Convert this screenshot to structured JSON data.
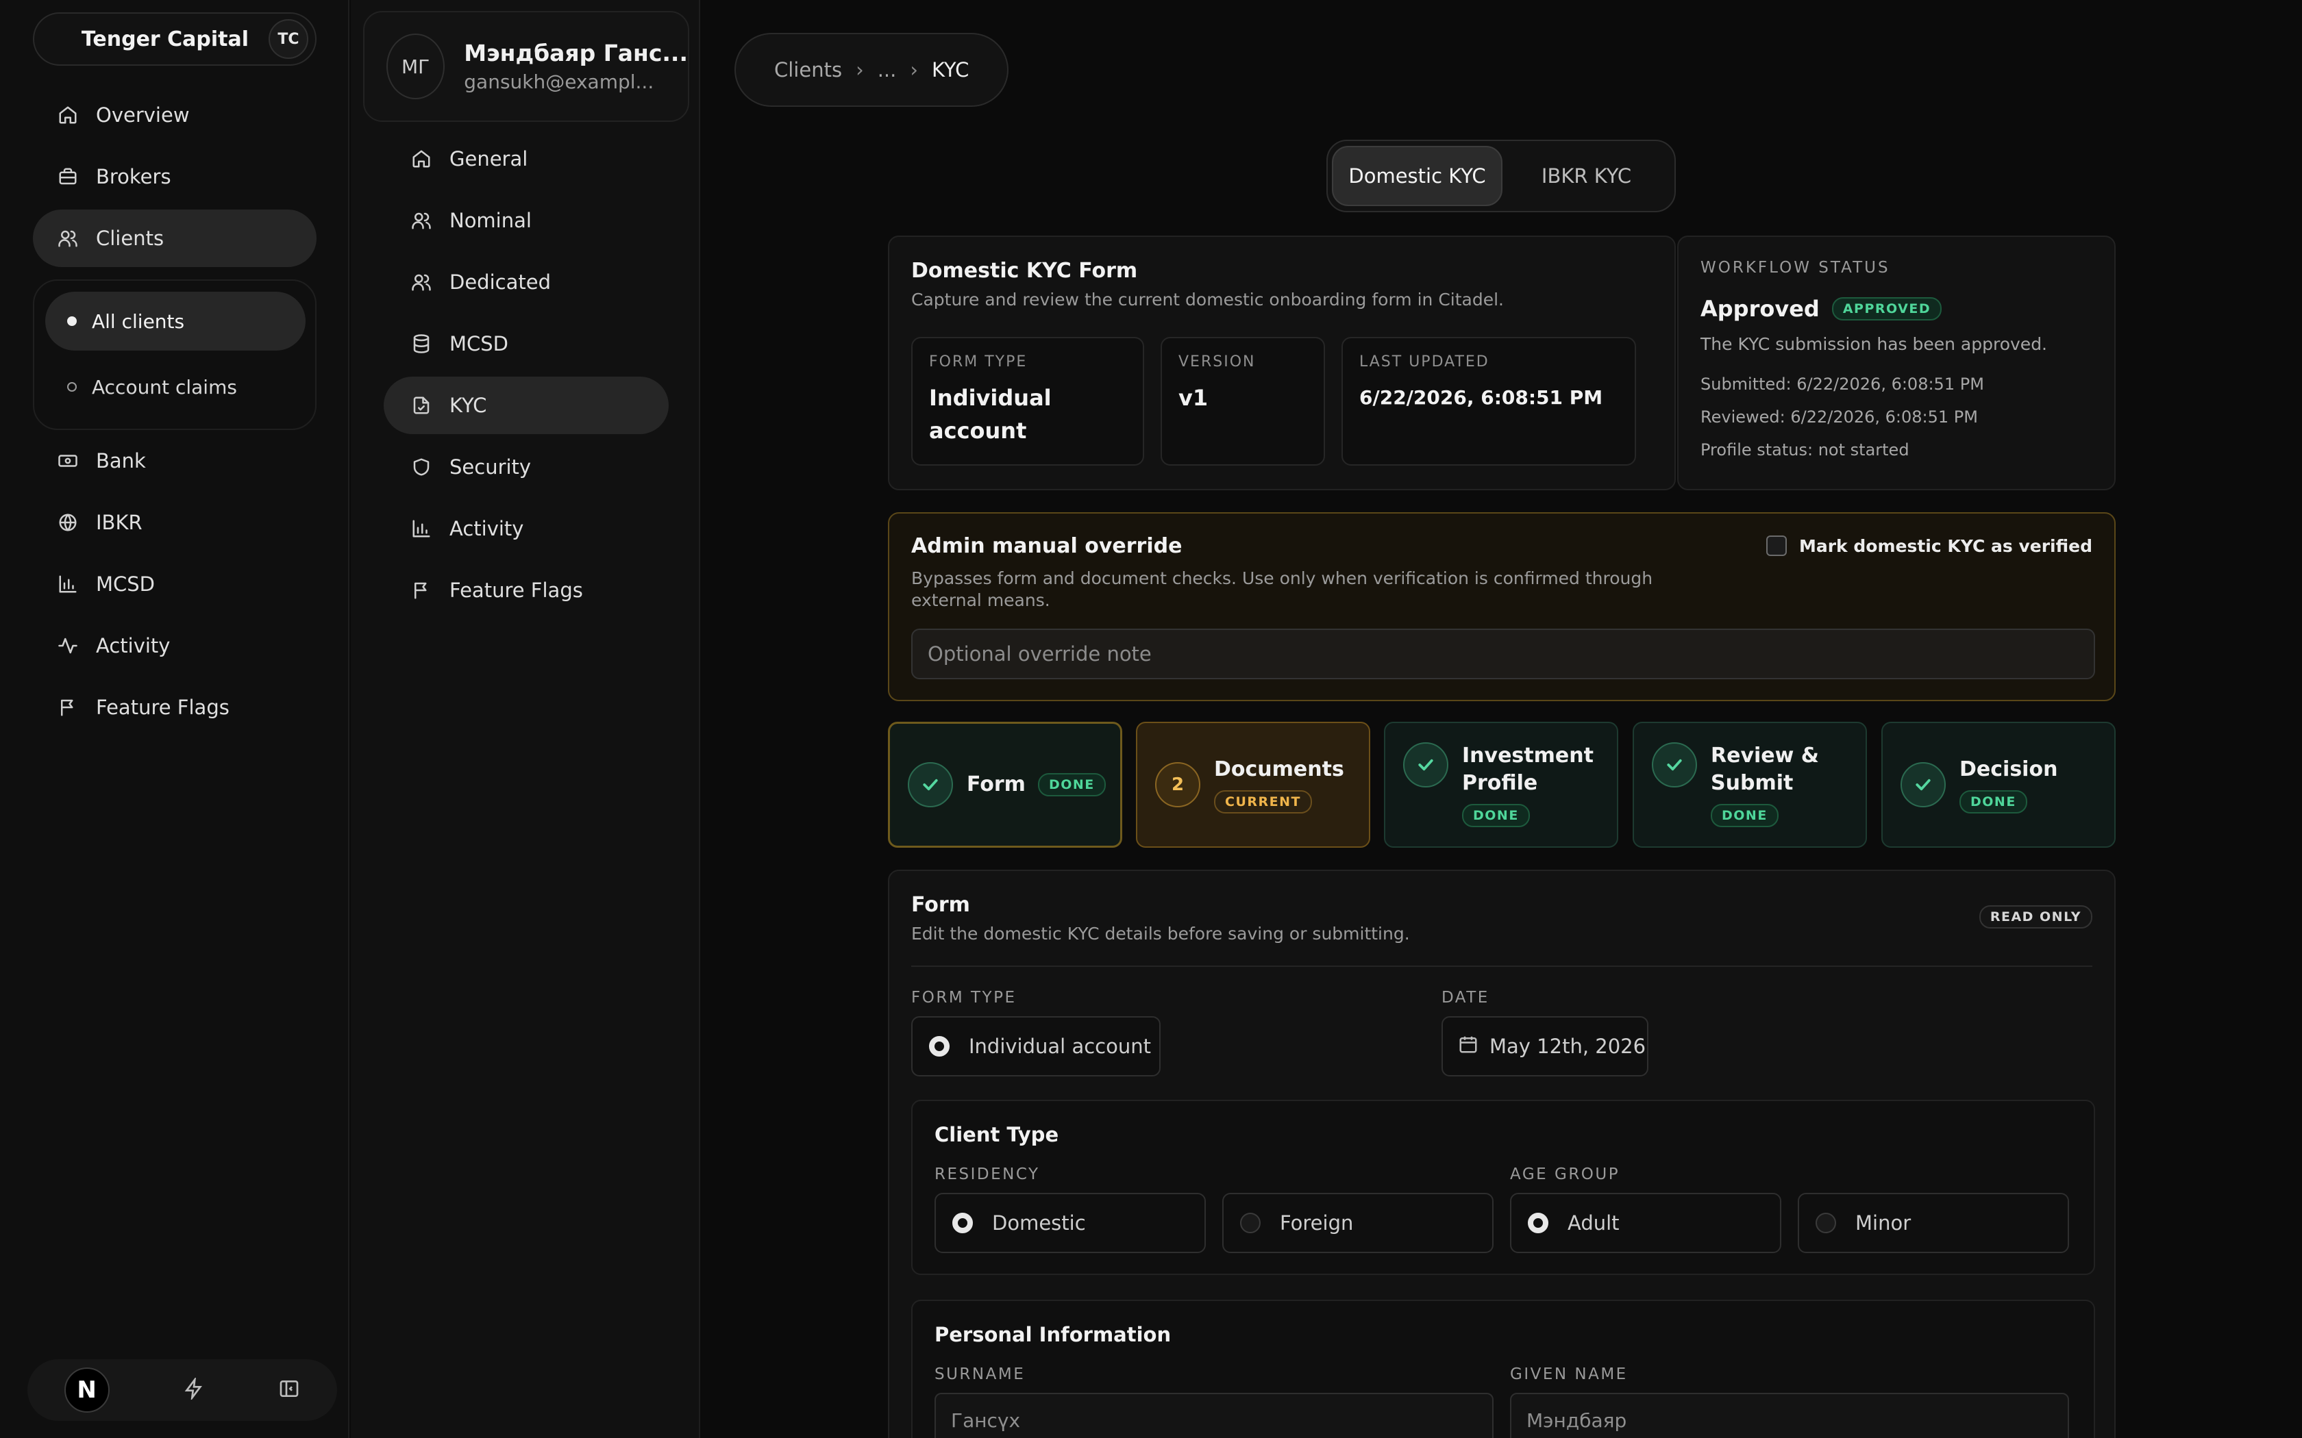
{
  "org": {
    "name": "Tenger Capital",
    "badge": "TC"
  },
  "sidebar": {
    "items": [
      {
        "label": "Overview",
        "icon": "home-icon"
      },
      {
        "label": "Brokers",
        "icon": "briefcase-icon"
      },
      {
        "label": "Clients",
        "icon": "users-icon"
      }
    ],
    "sub_items": [
      {
        "label": "All clients"
      },
      {
        "label": "Account claims"
      }
    ],
    "items_after": [
      {
        "label": "Bank",
        "icon": "banknote-icon"
      },
      {
        "label": "IBKR",
        "icon": "globe-icon"
      },
      {
        "label": "MCSD",
        "icon": "bar-chart-icon"
      },
      {
        "label": "Activity",
        "icon": "activity-icon"
      },
      {
        "label": "Feature Flags",
        "icon": "flag-icon"
      }
    ],
    "footer_logo": "N"
  },
  "client": {
    "initials": "МГ",
    "name": "Мэндбаяр Ганс...",
    "email": "gansukh@exampl...",
    "nav": [
      {
        "label": "General",
        "icon": "home-icon"
      },
      {
        "label": "Nominal",
        "icon": "users-icon"
      },
      {
        "label": "Dedicated",
        "icon": "users-icon"
      },
      {
        "label": "MCSD",
        "icon": "database-icon"
      },
      {
        "label": "KYC",
        "icon": "file-check-icon"
      },
      {
        "label": "Security",
        "icon": "shield-icon"
      },
      {
        "label": "Activity",
        "icon": "bar-chart-icon"
      },
      {
        "label": "Feature Flags",
        "icon": "flag-icon"
      }
    ]
  },
  "breadcrumb": {
    "root": "Clients",
    "ellipsis": "...",
    "current": "KYC"
  },
  "tabs": [
    "Domestic KYC",
    "IBKR KYC"
  ],
  "kyc_form": {
    "title": "Domestic KYC Form",
    "subtitle": "Capture and review the current domestic onboarding form in Citadel.",
    "form_type_label": "FORM TYPE",
    "form_type_value": "Individual account",
    "version_label": "VERSION",
    "version_value": "v1",
    "updated_label": "LAST UPDATED",
    "updated_value": "6/22/2026, 6:08:51 PM"
  },
  "workflow": {
    "label": "WORKFLOW STATUS",
    "status": "Approved",
    "badge": "APPROVED",
    "message": "The KYC submission has been approved.",
    "submitted": "Submitted: 6/22/2026, 6:08:51 PM",
    "reviewed": "Reviewed: 6/22/2026, 6:08:51 PM",
    "profile": "Profile status: not started"
  },
  "override": {
    "title": "Admin manual override",
    "description": "Bypasses form and document checks. Use only when verification is confirmed through external means.",
    "checkbox_label": "Mark domestic KYC as verified",
    "placeholder": "Optional override note"
  },
  "steps": [
    {
      "title": "Form",
      "badge": "DONE",
      "state": "done"
    },
    {
      "title": "Documents",
      "badge": "CURRENT",
      "state": "current",
      "number": "2"
    },
    {
      "title": "Investment Profile",
      "badge": "DONE",
      "state": "done"
    },
    {
      "title": "Review & Submit",
      "badge": "DONE",
      "state": "done"
    },
    {
      "title": "Decision",
      "badge": "DONE",
      "state": "done"
    }
  ],
  "form": {
    "title": "Form",
    "subtitle": "Edit the domestic KYC details before saving or submitting.",
    "badge": "READ ONLY",
    "form_type_label": "FORM TYPE",
    "form_type_value": "Individual account",
    "date_label": "DATE",
    "date_value": "May 12th, 2026",
    "client_type": {
      "title": "Client Type",
      "residency_label": "RESIDENCY",
      "residency_options": [
        "Domestic",
        "Foreign"
      ],
      "age_label": "AGE GROUP",
      "age_options": [
        "Adult",
        "Minor"
      ]
    },
    "personal": {
      "title": "Personal Information",
      "surname_label": "SURNAME",
      "surname_value": "Гансүх",
      "given_label": "GIVEN NAME",
      "given_value": "Мэндбаяр"
    }
  }
}
